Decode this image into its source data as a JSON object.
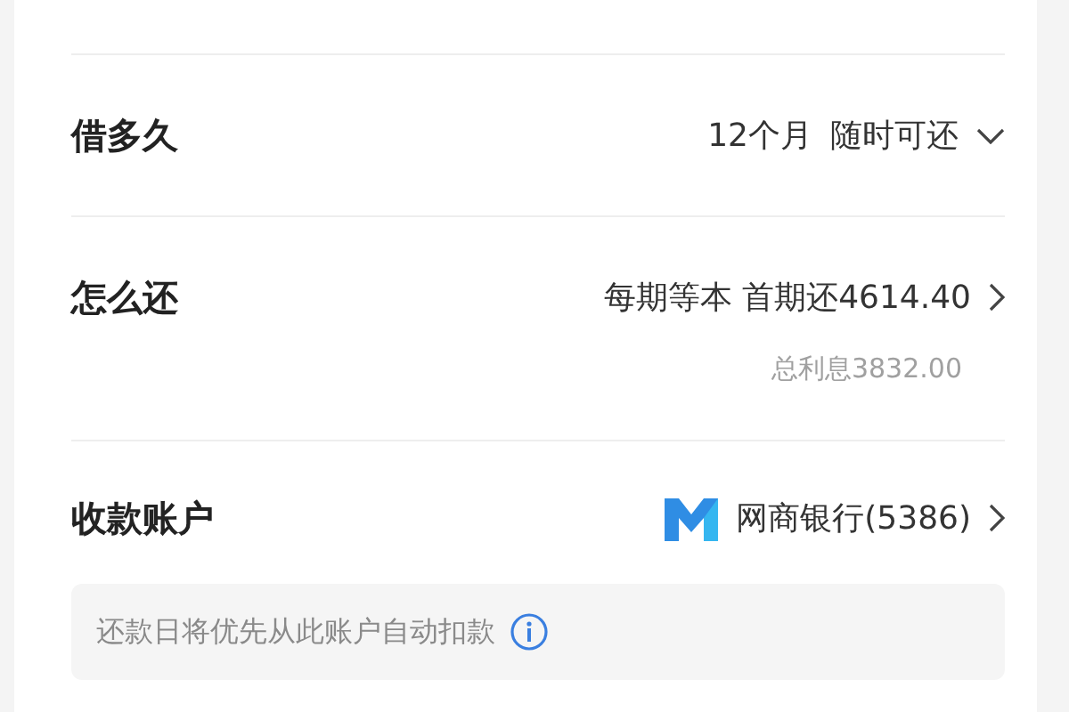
{
  "rows": [
    {
      "kind": "dropdown",
      "label": "借多久",
      "values": [
        "12个月",
        "随时可还"
      ]
    },
    {
      "kind": "link",
      "label": "怎么还",
      "values": [
        "每期等本 首期还4614.40"
      ],
      "note": "总利息3832.00"
    },
    {
      "kind": "account",
      "label": "收款账户",
      "values": [
        "网商银行(5386)"
      ],
      "tip": "还款日将优先从此账户自动扣款"
    }
  ]
}
